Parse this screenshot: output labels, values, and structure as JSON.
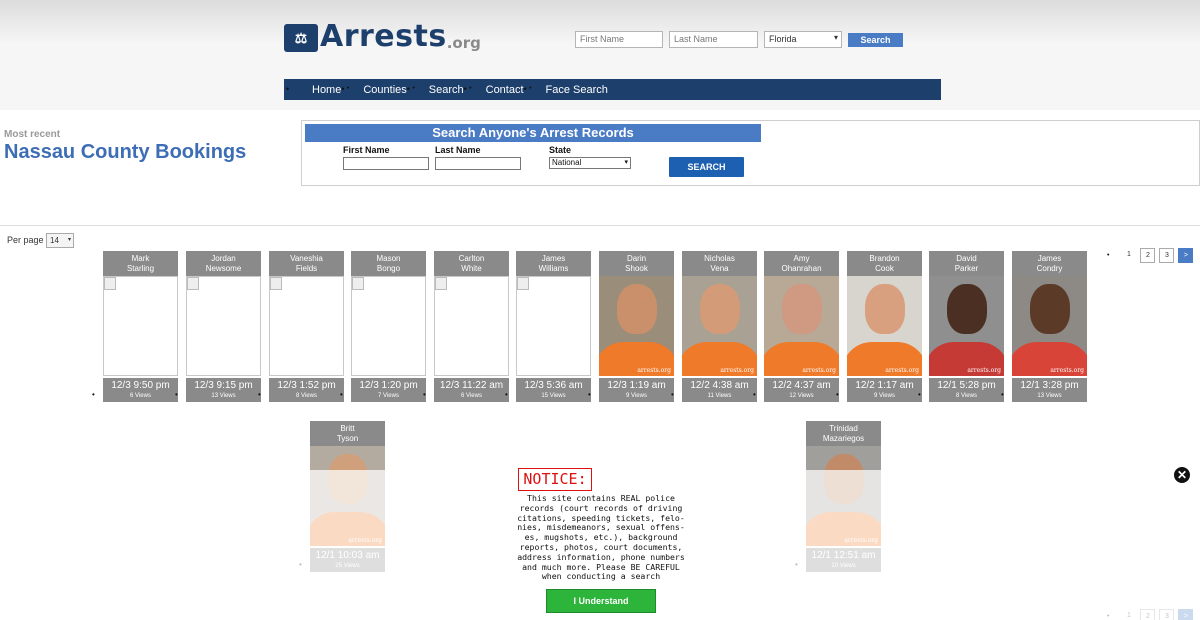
{
  "logo": {
    "text": "Arrests",
    "ext": ".org"
  },
  "header_search": {
    "first_placeholder": "First Name",
    "last_placeholder": "Last Name",
    "state_selected": "Florida",
    "button": "Search"
  },
  "nav": [
    "Home",
    "Counties",
    "Search",
    "Contact",
    "Face Search"
  ],
  "page": {
    "subtitle": "Most recent",
    "title": "Nassau County Bookings"
  },
  "search_box": {
    "title": "Search Anyone's Arrest Records",
    "first_label": "First Name",
    "last_label": "Last Name",
    "state_label": "State",
    "state_selected": "National",
    "button": "SEARCH"
  },
  "per_page": {
    "label": "Per page",
    "value": "14"
  },
  "pager": {
    "pages": [
      "1",
      "2",
      "3",
      ">"
    ]
  },
  "records": [
    {
      "first": "Mark",
      "last": "Starling",
      "time": "12/3 9:50 pm",
      "views": "6 Views",
      "photo": false
    },
    {
      "first": "Jordan",
      "last": "Newsome",
      "time": "12/3 9:15 pm",
      "views": "13 Views",
      "photo": false
    },
    {
      "first": "Vaneshia",
      "last": "Fields",
      "time": "12/3 1:52 pm",
      "views": "8 Views",
      "photo": false
    },
    {
      "first": "Mason",
      "last": "Bongo",
      "time": "12/3 1:20 pm",
      "views": "7 Views",
      "photo": false
    },
    {
      "first": "Carlton",
      "last": "White",
      "time": "12/3 11:22 am",
      "views": "6 Views",
      "photo": false
    },
    {
      "first": "James",
      "last": "Williams",
      "time": "12/3 5:36 am",
      "views": "15 Views",
      "photo": false
    },
    {
      "first": "Darin",
      "last": "Shook",
      "time": "12/3 1:19 am",
      "views": "9 Views",
      "photo": true
    },
    {
      "first": "Nicholas",
      "last": "Vena",
      "time": "12/2 4:38 am",
      "views": "11 Views",
      "photo": true
    },
    {
      "first": "Amy",
      "last": "Ohanrahan",
      "time": "12/2 4:37 am",
      "views": "12 Views",
      "photo": true
    },
    {
      "first": "Brandon",
      "last": "Cook",
      "time": "12/2 1:17 am",
      "views": "9 Views",
      "photo": true
    },
    {
      "first": "David",
      "last": "Parker",
      "time": "12/1 5:28 pm",
      "views": "8 Views",
      "photo": true
    },
    {
      "first": "James",
      "last": "Condry",
      "time": "12/1 3:28 pm",
      "views": "13 Views",
      "photo": true
    },
    {
      "first": "Britt",
      "last": "Tyson",
      "time": "12/1 10:03 am",
      "views": "25 Views",
      "photo": true
    },
    {
      "first": "Trinidad",
      "last": "Mazariegos",
      "time": "12/1 12:51 am",
      "views": "10 Views",
      "photo": true
    }
  ],
  "watermark": "arrests.org",
  "notice": {
    "title": "NOTICE:",
    "lines": [
      "This site contains REAL police",
      "records (court records of driving",
      "citations, speeding tickets, felo-",
      "nies, misdemeanors, sexual offens-",
      "es, mugshots, etc.), background",
      "reports, photos, court documents,",
      "address information, phone numbers",
      "and much more. Please BE CAREFUL",
      "when conducting a search"
    ],
    "button": "I Understand",
    "close": "✕"
  },
  "colors": {
    "brand": "#1d3f6c",
    "accent": "#4a7bc5",
    "title": "#3d6db5",
    "card": "#8a8a8a",
    "orange_shirt": "#ef7a2a",
    "confirm": "#2db43a"
  }
}
